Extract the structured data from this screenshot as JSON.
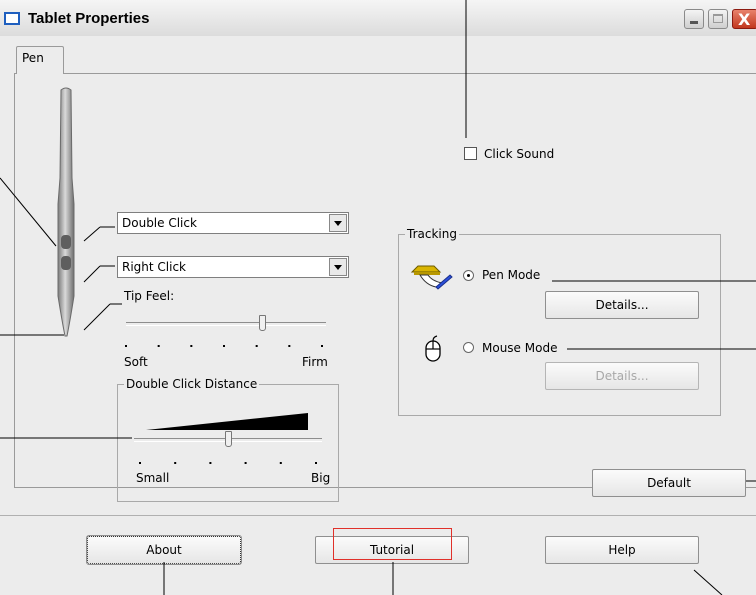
{
  "window": {
    "title": "Tablet Properties",
    "close_glyph": "X"
  },
  "tabs": [
    {
      "label": "Pen",
      "selected": true
    }
  ],
  "pen_buttons": {
    "upper": {
      "selected": "Double Click"
    },
    "lower": {
      "selected": "Right Click"
    }
  },
  "tip_feel": {
    "label": "Tip Feel:",
    "min_label": "Soft",
    "max_label": "Firm",
    "level": 0.68,
    "ticks": 7
  },
  "double_click_distance": {
    "label": "Double Click Distance",
    "min_label": "Small",
    "max_label": "Big",
    "level": 0.5,
    "ticks": 6
  },
  "click_sound": {
    "label": "Click Sound",
    "checked": false
  },
  "tracking": {
    "label": "Tracking",
    "pen_mode": {
      "label": "Pen Mode",
      "selected": true,
      "icon": "pen-tablet-icon"
    },
    "mouse_mode": {
      "label": "Mouse Mode",
      "selected": false,
      "icon": "mouse-icon"
    },
    "details_label": "Details..."
  },
  "buttons": {
    "default": "Default",
    "about": "About",
    "tutorial": "Tutorial",
    "help": "Help"
  },
  "colors": {
    "highlight": "#e0302a",
    "title_icon": "#1f5fbf",
    "close": "#c2381f"
  }
}
